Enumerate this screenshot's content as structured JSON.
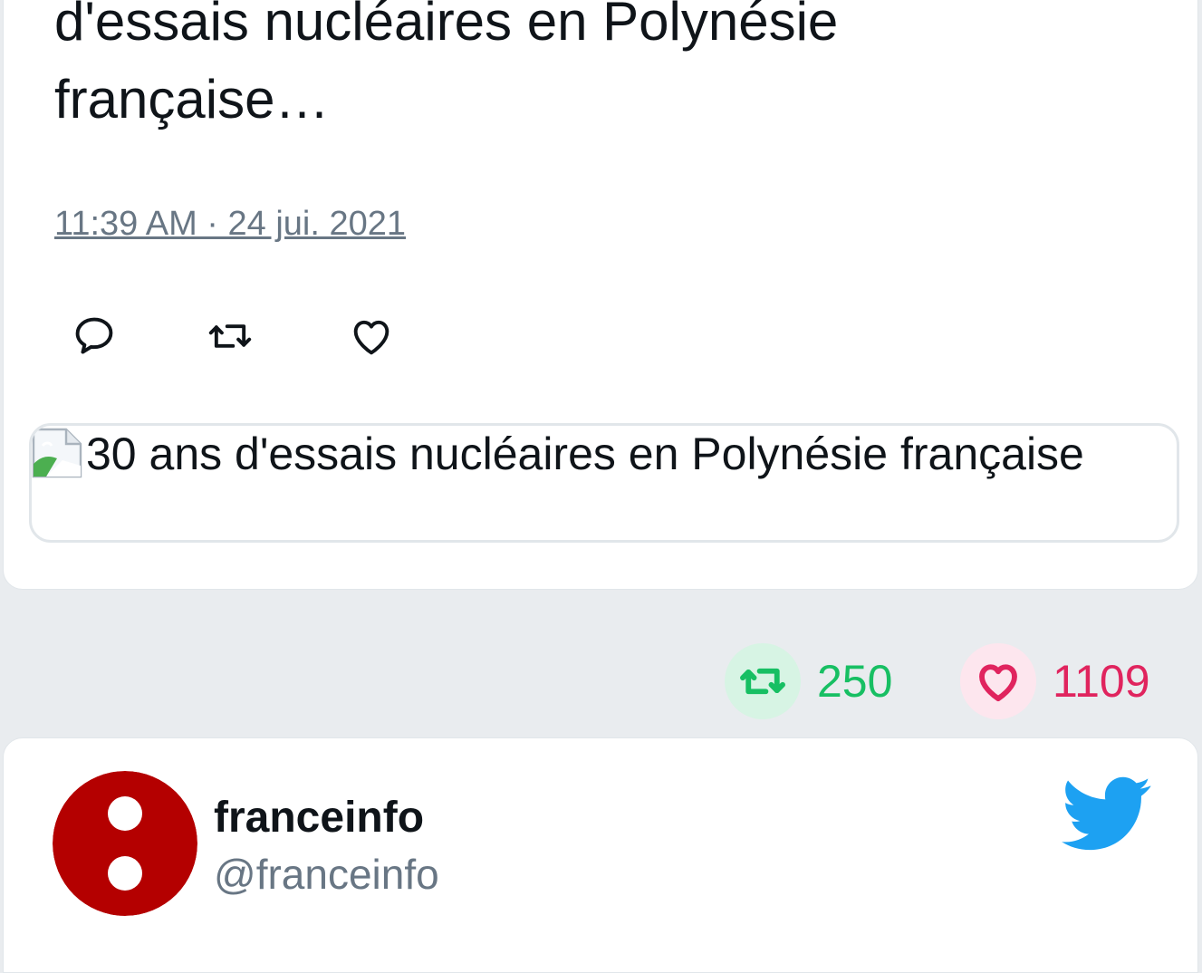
{
  "tweet": {
    "text": "d'essais nucléaires en Polynésie\nfrançaise…",
    "timestamp": "11:39 AM · 24 jui. 2021",
    "media_alt": "30 ans d'essais nucléaires en Polynésie française"
  },
  "actions": {
    "reply_icon": "reply-icon",
    "retweet_icon": "retweet-icon",
    "like_icon": "like-icon"
  },
  "stats": {
    "retweets": "250",
    "likes": "1109"
  },
  "author": {
    "name": "franceinfo",
    "handle": "@franceinfo"
  },
  "colors": {
    "background": "#e9ecef",
    "retweet_green": "#17bf63",
    "like_red": "#e0245e",
    "twitter_blue": "#1da1f2",
    "avatar_red": "#b40000",
    "muted_text": "#687684"
  }
}
